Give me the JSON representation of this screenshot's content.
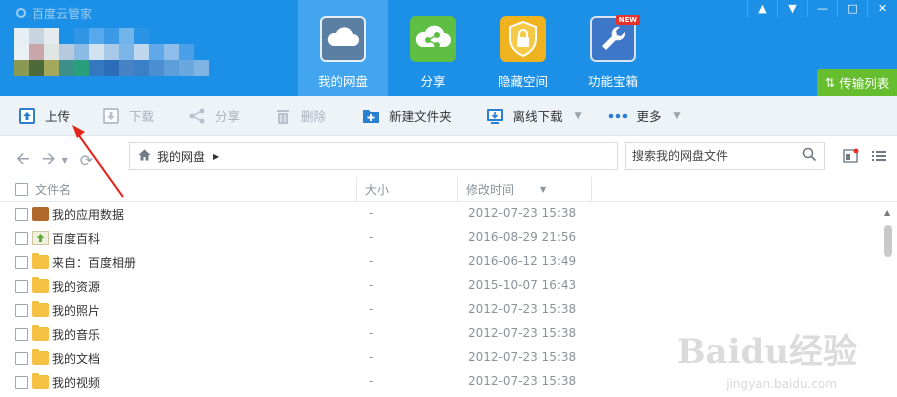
{
  "window": {
    "title": "百度云管家",
    "controls": [
      "bell-icon",
      "menu-icon",
      "minimize-icon",
      "maximize-icon",
      "close-icon"
    ]
  },
  "nav_tabs": [
    {
      "label": "我的网盘",
      "icon": "cloud-icon",
      "active": true
    },
    {
      "label": "分享",
      "icon": "share-icon",
      "active": false
    },
    {
      "label": "隐藏空间",
      "icon": "lock-icon",
      "active": false
    },
    {
      "label": "功能宝箱",
      "icon": "wrench-icon",
      "active": false,
      "badge": "NEW"
    }
  ],
  "transfer_button": {
    "label": "传输列表",
    "icon": "transfer-icon"
  },
  "toolbar": {
    "upload": "上传",
    "download": "下载",
    "share": "分享",
    "delete": "删除",
    "new_folder": "新建文件夹",
    "offline_download": "离线下载",
    "more": "更多"
  },
  "address": {
    "path": "我的网盘",
    "search_placeholder": "搜索我的网盘文件"
  },
  "table": {
    "headers": {
      "name": "文件名",
      "size": "大小",
      "modified": "修改时间"
    },
    "rows": [
      {
        "name": "我的应用数据",
        "size": "-",
        "date": "2012-07-23 15:38",
        "icon": "briefcase-icon"
      },
      {
        "name": "百度百科",
        "size": "-",
        "date": "2016-08-29 21:56",
        "icon": "upload-file-icon"
      },
      {
        "name": "来自：百度相册",
        "size": "-",
        "date": "2016-06-12 13:49",
        "icon": "folder-icon"
      },
      {
        "name": "我的资源",
        "size": "-",
        "date": "2015-10-07 16:43",
        "icon": "folder-icon"
      },
      {
        "name": "我的照片",
        "size": "-",
        "date": "2012-07-23 15:38",
        "icon": "folder-icon"
      },
      {
        "name": "我的音乐",
        "size": "-",
        "date": "2012-07-23 15:38",
        "icon": "folder-icon"
      },
      {
        "name": "我的文档",
        "size": "-",
        "date": "2012-07-23 15:38",
        "icon": "folder-icon"
      },
      {
        "name": "我的视频",
        "size": "-",
        "date": "2012-07-23 15:38",
        "icon": "folder-icon"
      }
    ]
  },
  "watermark": {
    "text": "Baidu经验",
    "sub": "jingyan.baidu.com"
  },
  "colors": {
    "header_blue": "#1c8fe6",
    "active_tab": "#43a4f0",
    "transfer_green": "#66be2e",
    "annotation_red": "#e3241b"
  }
}
